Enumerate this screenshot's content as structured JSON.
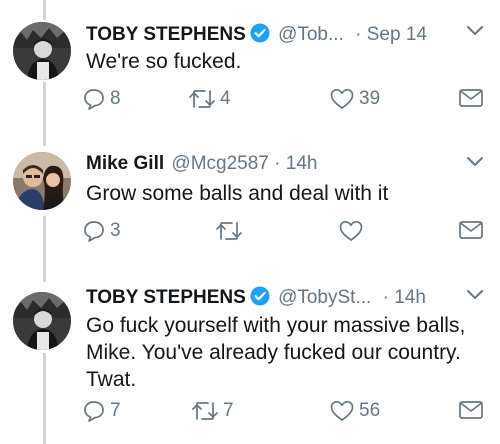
{
  "colors": {
    "text": "#14171a",
    "muted": "#657786",
    "verified": "#1da1f2",
    "thread_line": "#ccd6dd"
  },
  "tweets": [
    {
      "name": "TOBY STEPHENS",
      "verified": true,
      "handle": "@Tob...",
      "separator": "·",
      "time": "Sep 14",
      "text": [
        "We're so fucked."
      ],
      "replies": "8",
      "retweets": "4",
      "likes": "39",
      "avatar_icon": "avatar-dark-portrait"
    },
    {
      "name": "Mike Gill",
      "verified": false,
      "handle": "@Mcg2587",
      "separator": "·",
      "time": "14h",
      "text": [
        "Grow some balls and deal with it"
      ],
      "replies": "3",
      "retweets": "",
      "likes": "",
      "avatar_icon": "avatar-couple-photo"
    },
    {
      "name": "TOBY STEPHENS",
      "verified": true,
      "handle": "@TobySt...",
      "separator": "·",
      "time": "14h",
      "text": [
        "Go fuck yourself with your massive balls,",
        "Mike. You've already fucked our country.",
        "Twat."
      ],
      "replies": "7",
      "retweets": "7",
      "likes": "56",
      "avatar_icon": "avatar-dark-portrait"
    }
  ]
}
